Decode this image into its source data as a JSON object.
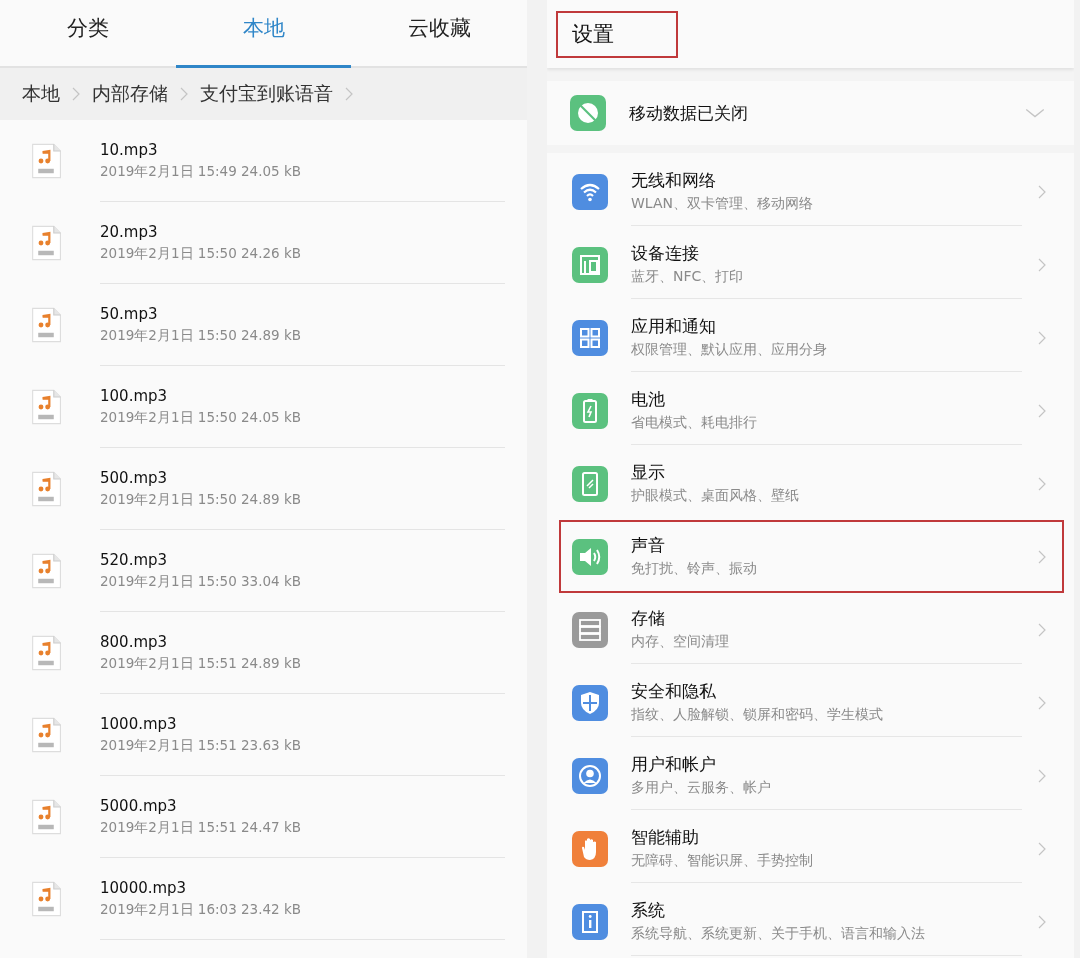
{
  "file_manager": {
    "tabs": [
      {
        "label": "分类",
        "selected": false
      },
      {
        "label": "本地",
        "selected": true
      },
      {
        "label": "云收藏",
        "selected": false
      }
    ],
    "breadcrumb": [
      "本地",
      "内部存储",
      "支付宝到账语音"
    ],
    "files": [
      {
        "name": "10.mp3",
        "details": "2019年2月1日 15:49 24.05 kB"
      },
      {
        "name": "20.mp3",
        "details": "2019年2月1日 15:50 24.26 kB"
      },
      {
        "name": "50.mp3",
        "details": "2019年2月1日 15:50 24.89 kB"
      },
      {
        "name": "100.mp3",
        "details": "2019年2月1日 15:50 24.05 kB"
      },
      {
        "name": "500.mp3",
        "details": "2019年2月1日 15:50 24.89 kB"
      },
      {
        "name": "520.mp3",
        "details": "2019年2月1日 15:50 33.04 kB"
      },
      {
        "name": "800.mp3",
        "details": "2019年2月1日 15:51 24.89 kB"
      },
      {
        "name": "1000.mp3",
        "details": "2019年2月1日 15:51 23.63 kB"
      },
      {
        "name": "5000.mp3",
        "details": "2019年2月1日 15:51 24.47 kB"
      },
      {
        "name": "10000.mp3",
        "details": "2019年2月1日 16:03 23.42 kB"
      }
    ]
  },
  "settings": {
    "title": {
      "text": "设置",
      "highlighted": true
    },
    "mobile_data": {
      "label": "移动数据已关闭",
      "color": "#5bc17f"
    },
    "items": [
      {
        "kind": "wifi",
        "color": "#4f8de0",
        "title": "无线和网络",
        "subtitle": "WLAN、双卡管理、移动网络",
        "highlighted": false
      },
      {
        "kind": "devices",
        "color": "#5bc17f",
        "title": "设备连接",
        "subtitle": "蓝牙、NFC、打印",
        "highlighted": false
      },
      {
        "kind": "apps",
        "color": "#4f8de0",
        "title": "应用和通知",
        "subtitle": "权限管理、默认应用、应用分身",
        "highlighted": false
      },
      {
        "kind": "battery",
        "color": "#5bc17f",
        "title": "电池",
        "subtitle": "省电模式、耗电排行",
        "highlighted": false
      },
      {
        "kind": "display",
        "color": "#5bc17f",
        "title": "显示",
        "subtitle": "护眼模式、桌面风格、壁纸",
        "highlighted": false
      },
      {
        "kind": "sound",
        "color": "#5bc17f",
        "title": "声音",
        "subtitle": "免打扰、铃声、振动",
        "highlighted": true
      },
      {
        "kind": "storage",
        "color": "#9a9a9a",
        "title": "存储",
        "subtitle": "内存、空间清理",
        "highlighted": false
      },
      {
        "kind": "security",
        "color": "#4f8de0",
        "title": "安全和隐私",
        "subtitle": "指纹、人脸解锁、锁屏和密码、学生模式",
        "highlighted": false
      },
      {
        "kind": "user",
        "color": "#4f8de0",
        "title": "用户和帐户",
        "subtitle": "多用户、云服务、帐户",
        "highlighted": false
      },
      {
        "kind": "hand",
        "color": "#f0803a",
        "title": "智能辅助",
        "subtitle": "无障碍、智能识屏、手势控制",
        "highlighted": false
      },
      {
        "kind": "system",
        "color": "#4f8de0",
        "title": "系统",
        "subtitle": "系统导航、系统更新、关于手机、语言和输入法",
        "highlighted": false
      }
    ]
  }
}
